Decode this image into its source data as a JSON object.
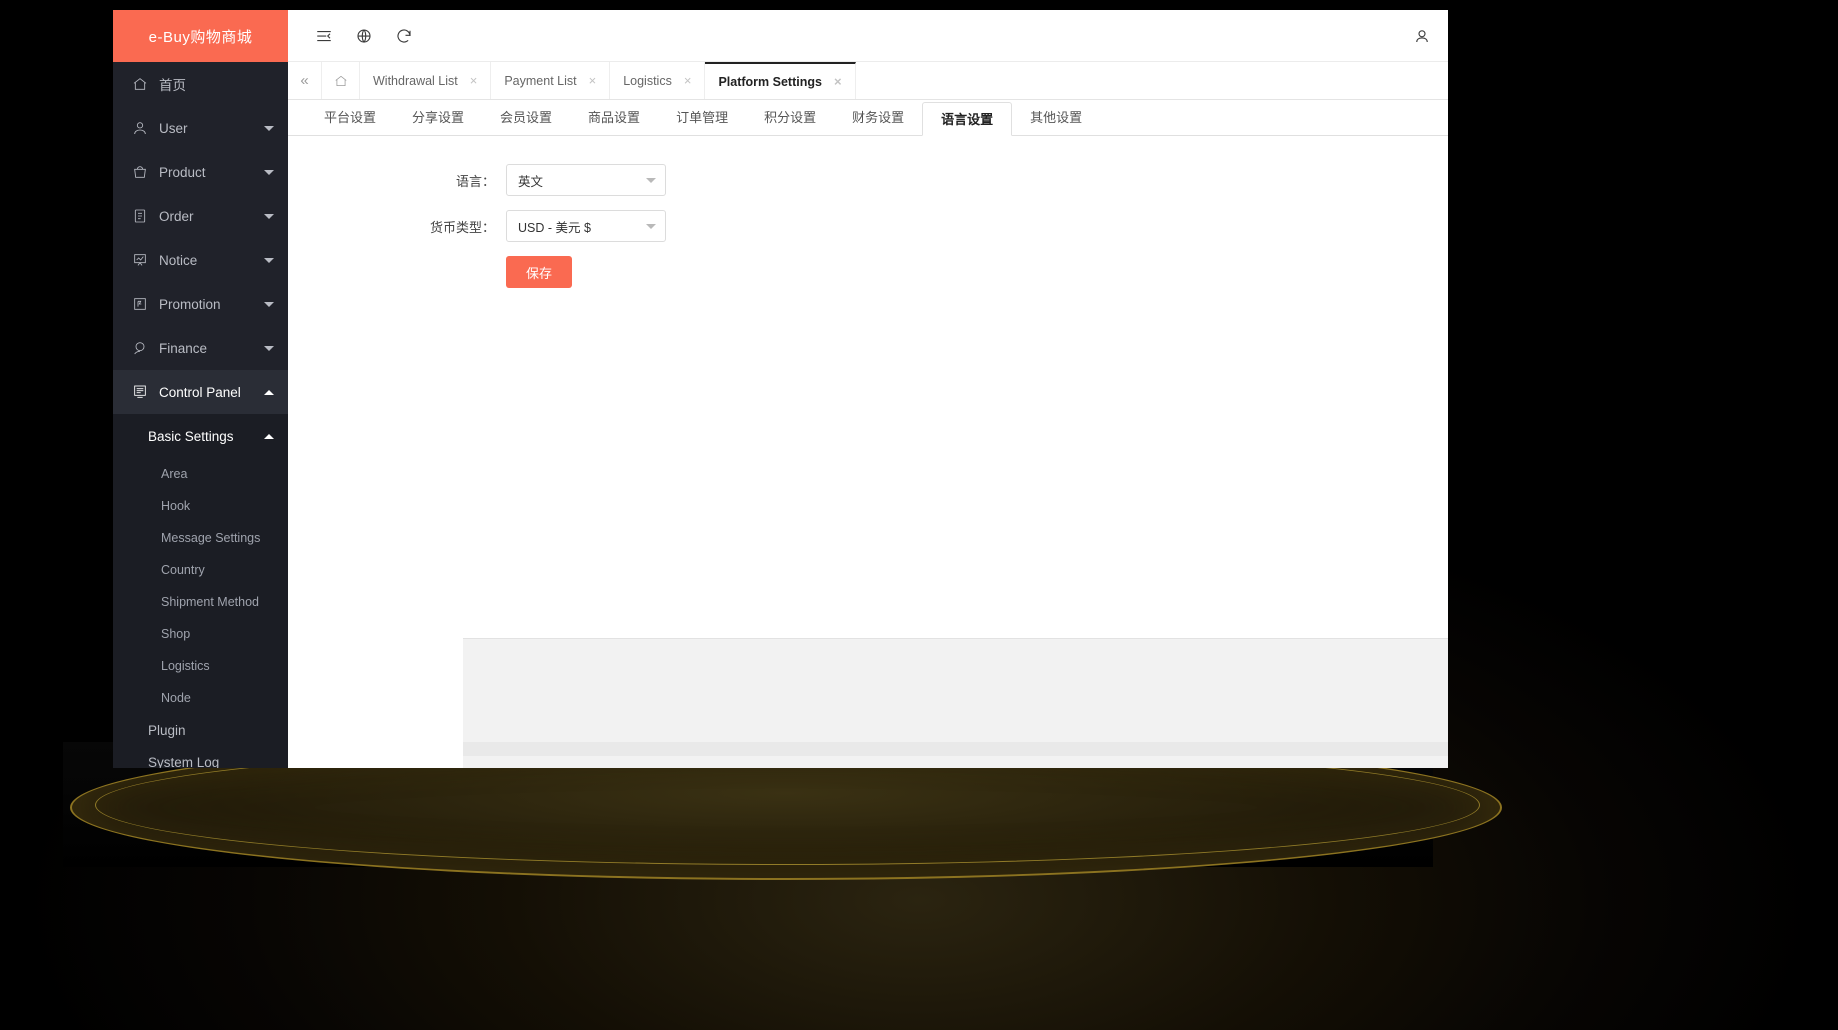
{
  "brand": {
    "title": "e-Buy购物商城",
    "color": "#fa6a51"
  },
  "topbar": {
    "collapse_icon": "menu-fold-icon",
    "language_icon": "globe-icon",
    "refresh_icon": "refresh-icon",
    "user_icon": "user-avatar-icon"
  },
  "sidebar": {
    "home": {
      "label": "首页",
      "icon": "home-icon"
    },
    "items": [
      {
        "label": "User",
        "icon": "user-icon",
        "expandable": true
      },
      {
        "label": "Product",
        "icon": "bag-icon",
        "expandable": true
      },
      {
        "label": "Order",
        "icon": "clipboard-icon",
        "expandable": true
      },
      {
        "label": "Notice",
        "icon": "chart-board-icon",
        "expandable": true
      },
      {
        "label": "Promotion",
        "icon": "promo-icon",
        "expandable": true
      },
      {
        "label": "Finance",
        "icon": "finance-icon",
        "expandable": true
      },
      {
        "label": "Control Panel",
        "icon": "control-panel-icon",
        "expandable": true,
        "expanded": true
      }
    ],
    "control_panel": {
      "basic_settings": {
        "label": "Basic Settings",
        "expanded": true
      },
      "basic_children": [
        {
          "label": "Area"
        },
        {
          "label": "Hook"
        },
        {
          "label": "Message Settings"
        },
        {
          "label": "Country"
        },
        {
          "label": "Shipment Method"
        },
        {
          "label": "Shop"
        },
        {
          "label": "Logistics"
        },
        {
          "label": "Node"
        }
      ],
      "others": [
        {
          "label": "Plugin"
        },
        {
          "label": "System Log"
        }
      ]
    }
  },
  "tabstrip": {
    "collapse_label": "«",
    "home_icon": "home-tab-icon",
    "tabs": [
      {
        "label": "Withdrawal List",
        "closable": true,
        "active": false
      },
      {
        "label": "Payment List",
        "closable": true,
        "active": false
      },
      {
        "label": "Logistics",
        "closable": true,
        "active": false
      },
      {
        "label": "Platform Settings",
        "closable": true,
        "active": true
      }
    ],
    "close_glyph": "×"
  },
  "settings_tabs": [
    {
      "label": "平台设置",
      "active": false
    },
    {
      "label": "分享设置",
      "active": false
    },
    {
      "label": "会员设置",
      "active": false
    },
    {
      "label": "商品设置",
      "active": false
    },
    {
      "label": "订单管理",
      "active": false
    },
    {
      "label": "积分设置",
      "active": false
    },
    {
      "label": "财务设置",
      "active": false
    },
    {
      "label": "语言设置",
      "active": true
    },
    {
      "label": "其他设置",
      "active": false
    }
  ],
  "form": {
    "language": {
      "label": "语言：",
      "value": "英文"
    },
    "currency": {
      "label": "货币类型：",
      "value": "USD - 美元 $"
    },
    "save_button": "保存"
  }
}
